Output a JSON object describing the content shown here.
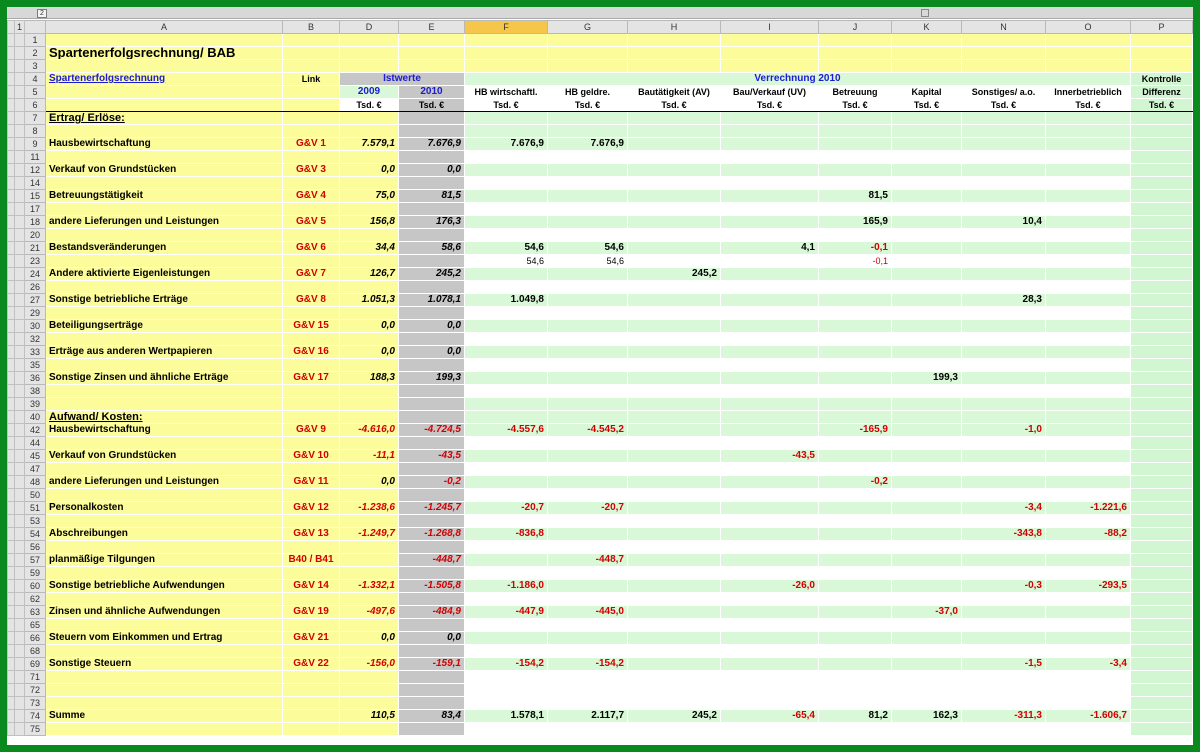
{
  "outline": {
    "level1": "1",
    "level2": "2"
  },
  "columns": [
    "A",
    "B",
    "D",
    "E",
    "F",
    "G",
    "H",
    "I",
    "J",
    "K",
    "N",
    "O",
    "P"
  ],
  "selected_column": "F",
  "title": "Spartenerfolgsrechnung/ BAB",
  "header": {
    "row4_label": "Spartenerfolgsrechnung",
    "link": "Link",
    "istwerte": "Istwerte",
    "verrechnung": "Verrechnung 2010",
    "kontrolle": "Kontrolle",
    "y2009": "2009",
    "y2010": "2010",
    "cols": [
      "HB  wirtschaftl.",
      "HB geldre.",
      "Bautätigkeit (AV)",
      "Bau/Verkauf (UV)",
      "Betreuung",
      "Kapital",
      "Sonstiges/ a.o.",
      "Innerbetrieblich"
    ],
    "differenz": "Differenz",
    "unit": "Tsd. €"
  },
  "sections": {
    "ertrag": "Ertrag/ Erlöse:",
    "aufwand": "Aufwand/ Kosten:"
  },
  "rows": [
    {
      "n": "8",
      "t": "b"
    },
    {
      "n": "9",
      "t": "d",
      "label": "Hausbewirtschaftung",
      "link": "G&V 1",
      "d": "7.579,1",
      "e": "7.676,9",
      "v": [
        "7.676,9",
        "7.676,9",
        "",
        "",
        "",
        "",
        "",
        ""
      ],
      "neg": false
    },
    {
      "n": "11",
      "t": "s"
    },
    {
      "n": "12",
      "t": "d",
      "label": "Verkauf von Grundstücken",
      "link": "G&V 3",
      "d": "0,0",
      "e": "0,0",
      "v": [
        "",
        "",
        "",
        "",
        "",
        "",
        "",
        ""
      ],
      "neg": false
    },
    {
      "n": "14",
      "t": "s"
    },
    {
      "n": "15",
      "t": "d",
      "label": "Betreuungstätigkeit",
      "link": "G&V 4",
      "d": "75,0",
      "e": "81,5",
      "v": [
        "",
        "",
        "",
        "",
        "81,5",
        "",
        "",
        ""
      ],
      "neg": false
    },
    {
      "n": "17",
      "t": "s"
    },
    {
      "n": "18",
      "t": "d",
      "label": "andere Lieferungen und Leistungen",
      "link": "G&V 5",
      "d": "156,8",
      "e": "176,3",
      "v": [
        "",
        "",
        "",
        "",
        "165,9",
        "",
        "10,4",
        ""
      ],
      "neg": false
    },
    {
      "n": "20",
      "t": "s"
    },
    {
      "n": "21",
      "t": "d",
      "label": "Bestandsveränderungen",
      "link": "G&V 6",
      "d": "34,4",
      "e": "58,6",
      "v": [
        "54,6",
        "54,6",
        "",
        "4,1",
        "-0,1",
        "",
        "",
        ""
      ],
      "neg": false
    },
    {
      "n": "23",
      "t": "x",
      "v": [
        "54,6",
        "54,6",
        "",
        "",
        "-0,1",
        "",
        "",
        ""
      ]
    },
    {
      "n": "24",
      "t": "d",
      "label": "Andere aktivierte Eigenleistungen",
      "link": "G&V 7",
      "d": "126,7",
      "e": "245,2",
      "v": [
        "",
        "",
        "245,2",
        "",
        "",
        "",
        "",
        ""
      ],
      "neg": false
    },
    {
      "n": "26",
      "t": "s"
    },
    {
      "n": "27",
      "t": "d",
      "label": "Sonstige betriebliche Erträge",
      "link": "G&V 8",
      "d": "1.051,3",
      "e": "1.078,1",
      "v": [
        "1.049,8",
        "",
        "",
        "",
        "",
        "",
        "28,3",
        ""
      ],
      "neg": false
    },
    {
      "n": "29",
      "t": "s"
    },
    {
      "n": "30",
      "t": "d",
      "label": "Beteiligungserträge",
      "link": "G&V 15",
      "d": "0,0",
      "e": "0,0",
      "v": [
        "",
        "",
        "",
        "",
        "",
        "",
        "",
        ""
      ],
      "neg": false
    },
    {
      "n": "32",
      "t": "s"
    },
    {
      "n": "33",
      "t": "d",
      "label": "Erträge aus anderen Wertpapieren",
      "link": "G&V 16",
      "d": "0,0",
      "e": "0,0",
      "v": [
        "",
        "",
        "",
        "",
        "",
        "",
        "",
        ""
      ],
      "neg": false
    },
    {
      "n": "35",
      "t": "s"
    },
    {
      "n": "36",
      "t": "d",
      "label": "Sonstige Zinsen und ähnliche Erträge",
      "link": "G&V 17",
      "d": "188,3",
      "e": "199,3",
      "v": [
        "",
        "",
        "",
        "",
        "",
        "199,3",
        "",
        ""
      ],
      "neg": false
    },
    {
      "n": "38",
      "t": "s"
    },
    {
      "n": "39",
      "t": "b"
    },
    {
      "n": "40",
      "t": "sec2"
    },
    {
      "n": "42",
      "t": "d",
      "label": "Hausbewirtschaftung",
      "link": "G&V 9",
      "d": "-4.616,0",
      "e": "-4.724,5",
      "v": [
        "-4.557,6",
        "-4.545,2",
        "",
        "",
        "-165,9",
        "",
        "-1,0",
        ""
      ],
      "neg": true
    },
    {
      "n": "44",
      "t": "s"
    },
    {
      "n": "45",
      "t": "d",
      "label": "Verkauf von Grundstücken",
      "link": "G&V 10",
      "d": "-11,1",
      "e": "-43,5",
      "v": [
        "",
        "",
        "",
        "-43,5",
        "",
        "",
        "",
        ""
      ],
      "neg": true
    },
    {
      "n": "47",
      "t": "s"
    },
    {
      "n": "48",
      "t": "d",
      "label": "andere Lieferungen und Leistungen",
      "link": "G&V 11",
      "d": "0,0",
      "e": "-0,2",
      "v": [
        "",
        "",
        "",
        "",
        "-0,2",
        "",
        "",
        ""
      ],
      "neg": true
    },
    {
      "n": "50",
      "t": "s"
    },
    {
      "n": "51",
      "t": "d",
      "label": "Personalkosten",
      "link": "G&V 12",
      "d": "-1.238,6",
      "e": "-1.245,7",
      "v": [
        "-20,7",
        "-20,7",
        "",
        "",
        "",
        "",
        "-3,4",
        "-1.221,6"
      ],
      "neg": true
    },
    {
      "n": "53",
      "t": "s"
    },
    {
      "n": "54",
      "t": "d",
      "label": "Abschreibungen",
      "link": "G&V 13",
      "d": "-1.249,7",
      "e": "-1.268,8",
      "v": [
        "-836,8",
        "",
        "",
        "",
        "",
        "",
        "-343,8",
        "-88,2"
      ],
      "neg": true
    },
    {
      "n": "56",
      "t": "s"
    },
    {
      "n": "57",
      "t": "d",
      "label": "planmäßige Tilgungen",
      "link": "B40 / B41",
      "d": "",
      "e": "-448,7",
      "v": [
        "",
        "-448,7",
        "",
        "",
        "",
        "",
        "",
        ""
      ],
      "neg": true
    },
    {
      "n": "59",
      "t": "s"
    },
    {
      "n": "60",
      "t": "d",
      "label": "Sonstige betriebliche Aufwendungen",
      "link": "G&V 14",
      "d": "-1.332,1",
      "e": "-1.505,8",
      "v": [
        "-1.186,0",
        "",
        "",
        "-26,0",
        "",
        "",
        "-0,3",
        "-293,5"
      ],
      "neg": true
    },
    {
      "n": "62",
      "t": "s"
    },
    {
      "n": "63",
      "t": "d",
      "label": "Zinsen und ähnliche Aufwendungen",
      "link": "G&V 19",
      "d": "-497,6",
      "e": "-484,9",
      "v": [
        "-447,9",
        "-445,0",
        "",
        "",
        "",
        "-37,0",
        "",
        ""
      ],
      "neg": true
    },
    {
      "n": "65",
      "t": "s"
    },
    {
      "n": "66",
      "t": "d",
      "label": "Steuern vom Einkommen und Ertrag",
      "link": "G&V 21",
      "d": "0,0",
      "e": "0,0",
      "v": [
        "",
        "",
        "",
        "",
        "",
        "",
        "",
        ""
      ],
      "neg": true
    },
    {
      "n": "68",
      "t": "s"
    },
    {
      "n": "69",
      "t": "d",
      "label": "Sonstige Steuern",
      "link": "G&V 22",
      "d": "-156,0",
      "e": "-159,1",
      "v": [
        "-154,2",
        "-154,2",
        "",
        "",
        "",
        "",
        "-1,5",
        "-3,4"
      ],
      "neg": true
    },
    {
      "n": "71",
      "t": "s"
    },
    {
      "n": "72",
      "t": "s"
    },
    {
      "n": "73",
      "t": "s"
    },
    {
      "n": "74",
      "t": "sum",
      "label": "Summe",
      "d": "110,5",
      "e": "83,4",
      "v": [
        "1.578,1",
        "2.117,7",
        "245,2",
        "-65,4",
        "81,2",
        "162,3",
        "-311,3",
        "-1.606,7"
      ]
    },
    {
      "n": "75",
      "t": "s"
    }
  ]
}
